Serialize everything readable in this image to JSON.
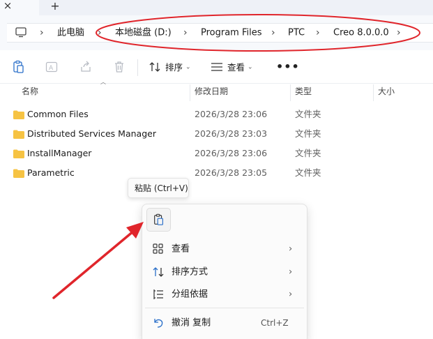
{
  "tabs": {
    "close_icon": "×",
    "new_icon": "+"
  },
  "breadcrumb": {
    "items": [
      "此电脑",
      "本地磁盘 (D:)",
      "Program Files",
      "PTC",
      "Creo 8.0.0.0"
    ],
    "separator": "›"
  },
  "toolbar": {
    "sort_label": "排序",
    "view_label": "查看",
    "more_label": "•••",
    "caret": "⌄"
  },
  "columns": {
    "name": "名称",
    "modified": "修改日期",
    "type": "类型",
    "size": "大小"
  },
  "files": [
    {
      "name": "Common Files",
      "modified": "2026/3/28 23:06",
      "type": "文件夹"
    },
    {
      "name": "Distributed Services Manager",
      "modified": "2026/3/28 23:03",
      "type": "文件夹"
    },
    {
      "name": "InstallManager",
      "modified": "2026/3/28 23:06",
      "type": "文件夹"
    },
    {
      "name": "Parametric",
      "modified": "2026/3/28 23:05",
      "type": "文件夹"
    }
  ],
  "tooltip": {
    "text": "粘贴 (Ctrl+V)"
  },
  "context_menu": {
    "items": [
      {
        "label": "查看",
        "arrow": "›"
      },
      {
        "label": "排序方式",
        "arrow": "›"
      },
      {
        "label": "分组依据",
        "arrow": "›"
      },
      {
        "label": "撤消 复制",
        "shortcut": "Ctrl+Z"
      }
    ]
  },
  "colors": {
    "annotation_red": "#e0252b",
    "folder": "#f6c343",
    "accent": "#2a6fc9"
  }
}
